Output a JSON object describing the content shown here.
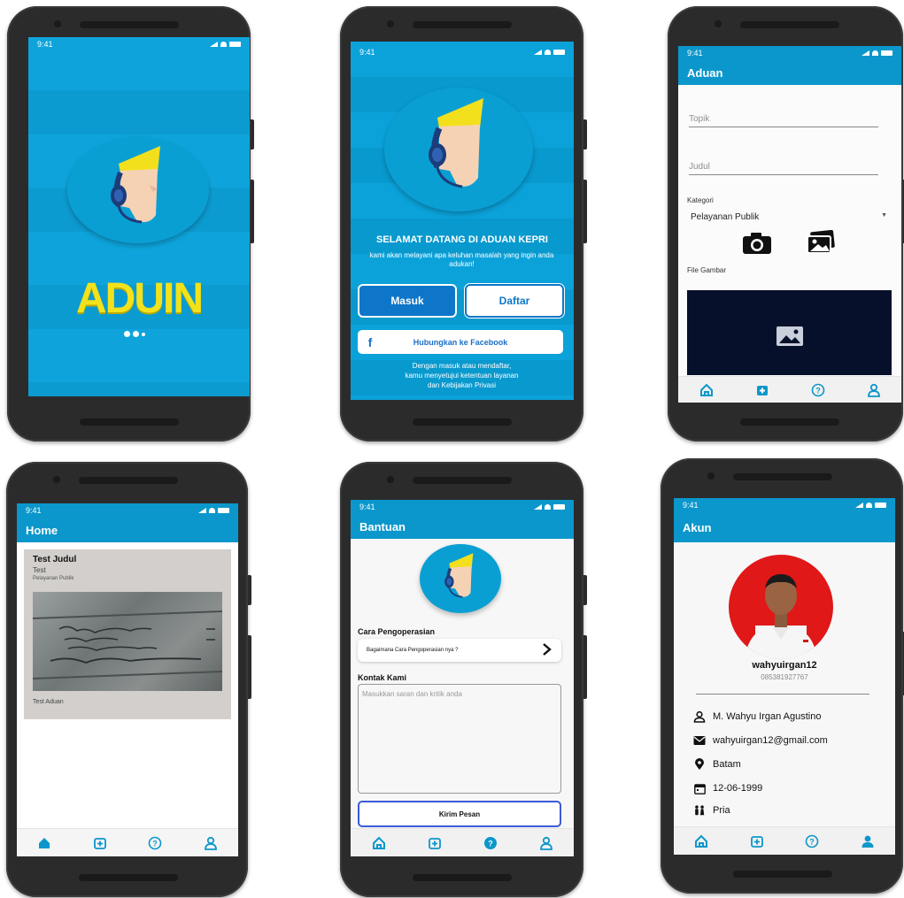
{
  "status": {
    "time": "9:41"
  },
  "screens": {
    "splash": {
      "logo_text": "ADUIN"
    },
    "welcome": {
      "title": "SELAMAT DATANG DI ADUAN KEPRI",
      "subtitle": "kami akan melayani apa keluhan masalah yang ingin anda adukan!",
      "login_label": "Masuk",
      "register_label": "Daftar",
      "facebook_label": "Hubungkan ke Facebook",
      "terms_line1": "Dengan masuk atau mendaftar,",
      "terms_line2": "kamu menyetujui ketentuan layanan",
      "terms_line3": "dan Kebijakan Privasi"
    },
    "aduan": {
      "title": "Aduan",
      "topic_placeholder": "Topik",
      "title_placeholder": "Judul",
      "category_label": "Kategori",
      "category_value": "Pelayanan Publik",
      "file_label": "File Gambar"
    },
    "home": {
      "title": "Home",
      "post_title": "Test Judul",
      "post_subtitle": "Test",
      "post_category": "Pelayanan Publik",
      "post_caption": "Test Aduan"
    },
    "bantuan": {
      "title": "Bantuan",
      "section_operation": "Cara Pengoperasian",
      "operation_item": "Bagaimana Cara Pengoperasian nya ?",
      "section_contact": "Kontak Kami",
      "message_placeholder": "Masukkan saran dan kritik anda",
      "send_label": "Kirim Pesan"
    },
    "akun": {
      "title": "Akun",
      "username": "wahyuirgan12",
      "phone": "085381927767",
      "full_name": "M. Wahyu Irgan Agustino",
      "email": "wahyuirgan12@gmail.com",
      "city": "Batam",
      "birth_date": "12-06-1999",
      "gender": "Pria"
    }
  },
  "colors": {
    "primary": "#0b97cb",
    "accent_yellow": "#f2e21b",
    "nav_active": "#0b97cb"
  },
  "icons": [
    "home-icon",
    "add-icon",
    "help-icon",
    "user-icon",
    "camera-icon",
    "gallery-icon",
    "image-icon",
    "facebook-icon",
    "chevron-right-icon",
    "person-icon",
    "mail-icon",
    "location-icon",
    "calendar-icon",
    "gender-icon"
  ]
}
